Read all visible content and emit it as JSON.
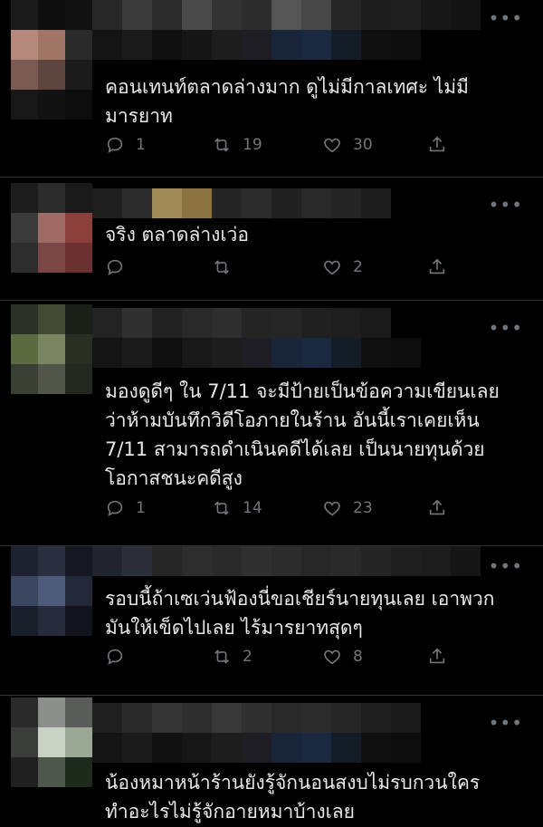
{
  "tweets": [
    {
      "text": "คอนเทนท์ตลาดล่างมาก ดูไม่มีกาลเทศะ ไม่มี\nมารยาท",
      "replies": "1",
      "retweets": "19",
      "likes": "30",
      "avatar_colors": [
        "#1b1b1b",
        "#0e0e0e",
        "#111",
        "#b58a7c",
        "#a17566",
        "#2a2a2a",
        "#7a5a52",
        "#5d4640",
        "#1a1a1a",
        "#181818",
        "#121212",
        "#0d0d0d"
      ],
      "header_colors": [
        "#272727",
        "#3a3a3a",
        "#2b2b2b",
        "#494949",
        "#333",
        "#2c2c2c",
        "#555",
        "#474747",
        "#262626",
        "#1c1c1c",
        "#1f1f1f",
        "#171717",
        "#131313"
      ],
      "header2_colors": [
        "#141414",
        "#1a1a1a",
        "#101010",
        "#161616",
        "#1d1d1d",
        "#1e1e24",
        "#18253a",
        "#192a40",
        "#141c28",
        "#101010",
        "#0d0d0d"
      ]
    },
    {
      "text": "จริง ตลาดล่างเว่อ",
      "replies": "",
      "retweets": "",
      "likes": "2",
      "avatar_colors": [
        "#1c1c1c",
        "#2c2c2c",
        "#191919",
        "#3a3a3a",
        "#a06a66",
        "#8a3f3b",
        "#2d2d2d",
        "#7a4545",
        "#6b2f2f"
      ],
      "header_colors": [
        "#1e1e1e",
        "#2b2b2b",
        "#a08b58",
        "#8a7340",
        "#252525",
        "#2c2c2c",
        "#212121",
        "#292929",
        "#242424",
        "#1d1d1d"
      ]
    },
    {
      "text": "มองดูดีๆ ใน 7/11 จะมีป้ายเป็นข้อความเขียนเลย\nว่าห้ามบันทึกวิดีโอภายในร้าน อันนี้เราเคยเห็น\n7/11 สามารถดำเนินคดีได้เลย เป็นนายทุนด้วย\nโอกาสชนะคดีสูง",
      "replies": "1",
      "retweets": "14",
      "likes": "23",
      "avatar_colors": [
        "#2c3127",
        "#434a33",
        "#1c1f18",
        "#5b6a3f",
        "#7b8461",
        "#2b2f22",
        "#3a3f33",
        "#52564a",
        "#25281f"
      ],
      "header_colors": [
        "#232323",
        "#303030",
        "#222",
        "#292929",
        "#2e2e2e",
        "#242424",
        "#262626",
        "#202020",
        "#1e1e1e",
        "#1a1a1a"
      ],
      "header2_colors": [
        "#141414",
        "#1a1a1a",
        "#101010",
        "#181818",
        "#1d1d1d",
        "#1e1e24",
        "#18253a",
        "#192a40",
        "#141c28",
        "#101010",
        "#0d0d0d"
      ]
    },
    {
      "text": "รอบนี้ถ้าเซเว่นฟ้องนี่ขอเชียร์นายทุนเลย เอาพวก\nมันให้เข็ดไปเลย ไร้มารยาทสุดๆ",
      "replies": "",
      "retweets": "2",
      "likes": "8",
      "avatar_colors": [
        "#1d2230",
        "#2b3040",
        "#151820",
        "#3a4560",
        "#4d5a7a",
        "#222838",
        "#1b1f2b",
        "#262c3c",
        "#11141c"
      ],
      "header_colors": [
        "#22252e",
        "#2b2e36",
        "#262626",
        "#2d2d2d",
        "#2a2a2a",
        "#303030",
        "#2c2c2c",
        "#272727",
        "#2a2a2a",
        "#242424",
        "#1f1f1f",
        "#1c1c1c",
        "#161616"
      ]
    },
    {
      "text": "น้องหมาหน้าร้านยังรู้จักนอนสงบไม่รบกวนใคร\nทำอะไรไม่รู้จักอายหมาบ้างเลย",
      "replies": "",
      "retweets": "",
      "likes": "",
      "avatar_colors": [
        "#2a2a2a",
        "#8d8f8d",
        "#5a5c5a",
        "#3b3d3b",
        "#c9d1c3",
        "#9aa896",
        "#202020",
        "#4d574b",
        "#1e2a1c"
      ],
      "header_colors": [
        "#202020",
        "#2a2a2a",
        "#353535",
        "#2e2e2e",
        "#383838",
        "#303030",
        "#292929",
        "#2b2b2b",
        "#262626",
        "#1e1e1e",
        "#1a1a1a"
      ],
      "header2_colors": [
        "#151515",
        "#1b1b1b",
        "#121212",
        "#171717",
        "#1d1d1d",
        "#1e1e24",
        "#18253a",
        "#192a40",
        "#141c28",
        "#101010",
        "#0d0d0d"
      ]
    }
  ]
}
